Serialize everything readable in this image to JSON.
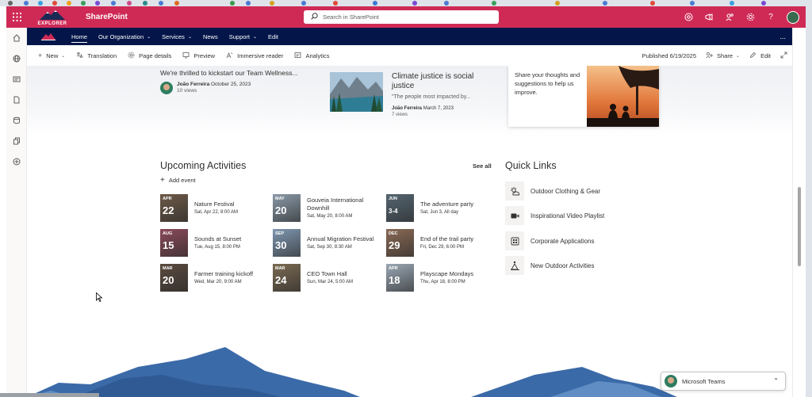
{
  "suite": {
    "app_name": "SharePoint",
    "logo_text": "EXPLORER",
    "search_placeholder": "Search in SharePoint"
  },
  "hub_nav": {
    "items": [
      {
        "label": "Home",
        "chevron": false,
        "active": true
      },
      {
        "label": "Our Organization",
        "chevron": true,
        "active": false
      },
      {
        "label": "Services",
        "chevron": true,
        "active": false
      },
      {
        "label": "News",
        "chevron": false,
        "active": false
      },
      {
        "label": "Support",
        "chevron": true,
        "active": false
      },
      {
        "label": "Edit",
        "chevron": false,
        "active": false
      }
    ],
    "more": "..."
  },
  "command_bar": {
    "new_label": "New",
    "translation_label": "Translation",
    "page_details_label": "Page details",
    "preview_label": "Preview",
    "immersive_reader_label": "Immersive reader",
    "analytics_label": "Analytics",
    "published_label": "Published 6/19/2025",
    "share_label": "Share",
    "edit_label": "Edit"
  },
  "news": [
    {
      "title": "We're thrilled to kickstart our Team Wellness...",
      "author": "João Ferreira",
      "date": "October 25, 2023",
      "views": "10 views"
    },
    {
      "title": "Climate justice is social justice",
      "excerpt": "\"The people most impacted by...",
      "author": "João Ferreira",
      "date": "March 7, 2023",
      "views": "7 views"
    }
  ],
  "promo": {
    "text": "Share your thoughts and suggestions to help us improve."
  },
  "upcoming": {
    "title": "Upcoming Activities",
    "see_all": "See all",
    "add_event": "Add event",
    "events": [
      {
        "month": "APR",
        "day": "22",
        "title": "Nature Festival",
        "time": "Sat, Apr 22, 8:00 AM",
        "color": "#6d5a48"
      },
      {
        "month": "MAY",
        "day": "20",
        "title": "Gouveia International Downhill",
        "time": "Sat, May 20, 8:00 AM",
        "color": "#8a9aa8"
      },
      {
        "month": "JUN",
        "day": "3-4",
        "title": "The adventure party",
        "time": "Sat, Jun 3, All day",
        "color": "#556672"
      },
      {
        "month": "AUG",
        "day": "15",
        "title": "Sounds at Sunset",
        "time": "Tue, Aug 15, 8:00 PM",
        "color": "#8a4a5a"
      },
      {
        "month": "SEP",
        "day": "30",
        "title": "Annual Migration Festival",
        "time": "Sat, Sep 30, 8:30 AM",
        "color": "#7f97b0"
      },
      {
        "month": "DEC",
        "day": "29",
        "title": "End of the trail party",
        "time": "Fri, Dec 29, 6:00 PM",
        "color": "#8a6a55"
      },
      {
        "month": "MAR",
        "day": "20",
        "title": "Farmer training kickoff",
        "time": "Wed, Mar 20, 9:00 AM",
        "color": "#5a4a3e"
      },
      {
        "month": "MAR",
        "day": "24",
        "title": "CEO Town Hall",
        "time": "Sun, Mar 24, 5:00 AM",
        "color": "#7b6a52"
      },
      {
        "month": "APR",
        "day": "18",
        "title": "Playscape Mondays",
        "time": "Thu, Apr 18, 8:00 PM",
        "color": "#9aa8b5"
      }
    ]
  },
  "quick_links": {
    "title": "Quick Links",
    "items": [
      {
        "label": "Outdoor Clothing & Gear",
        "icon": "weather-icon"
      },
      {
        "label": "Inspirational Video Playlist",
        "icon": "video-icon"
      },
      {
        "label": "Corporate Applications",
        "icon": "apps-icon"
      },
      {
        "label": "New Outdoor Activities",
        "icon": "hiking-icon"
      }
    ]
  },
  "teams": {
    "label": "Microsoft Teams"
  },
  "colors": {
    "suite_bar": "#cf2a56",
    "hub_nav": "#041649",
    "mountain_dark": "#3b6aa8",
    "mountain_light": "#5f8dc4"
  }
}
